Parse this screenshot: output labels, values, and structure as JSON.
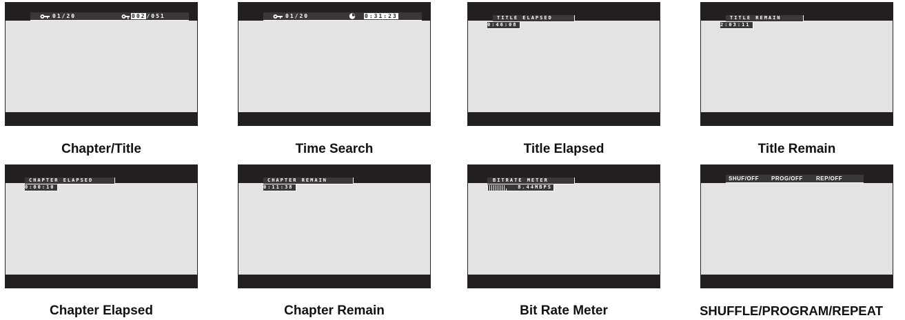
{
  "panels": [
    {
      "caption": "Chapter/Title",
      "osd": {
        "chapter": "01/20",
        "title_prefix": "",
        "title_current": "002",
        "title_total": "/051",
        "icon_left": "key-icon",
        "icon_right": "title-key-icon"
      }
    },
    {
      "caption": "Time Search",
      "osd": {
        "chapter": "01/20",
        "time": "0:31:23",
        "icon_left": "key-icon",
        "icon_right": "clock-icon"
      }
    },
    {
      "caption": "Title Elapsed",
      "osd": {
        "label": "TITLE ELAPSED",
        "value": "0:46:08"
      }
    },
    {
      "caption": "Title Remain",
      "osd": {
        "label": "TITLE REMAIN",
        "value": "2:03:11"
      }
    },
    {
      "caption": "Chapter Elapsed",
      "osd": {
        "label": "CHAPTER ELAPSED",
        "value": "0:00:10"
      }
    },
    {
      "caption": "Chapter Remain",
      "osd": {
        "label": "CHAPTER REMAIN",
        "value": "0:11:38"
      }
    },
    {
      "caption": "Bit Rate Meter",
      "osd": {
        "label": "BITRATE METER",
        "value": "8.44MBPS",
        "meter_level": 0.5
      }
    },
    {
      "caption": "SHUFFLE/PROGRAM/REPEAT",
      "osd": {
        "shuffle": "SHUF/OFF",
        "program": "PROG/OFF",
        "repeat": "REP/OFF"
      }
    }
  ],
  "colors": {
    "screen": "#e3e3e3",
    "bar": "#231f20",
    "osd_bg": "#3b3637",
    "osd_text": "#ffffff"
  }
}
